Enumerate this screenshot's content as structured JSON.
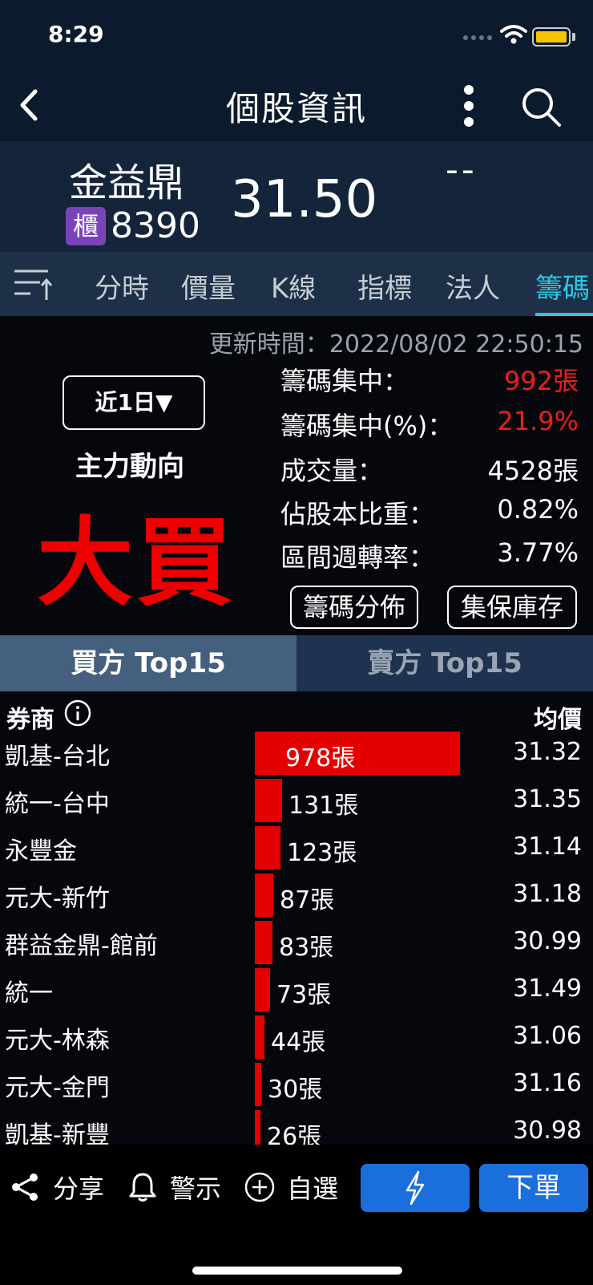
{
  "status": {
    "time": "8:29"
  },
  "nav": {
    "title": "個股資訊"
  },
  "stock": {
    "name": "金益鼎",
    "market_badge": "櫃",
    "code": "8390",
    "price": "31.50",
    "change": "--"
  },
  "tabs": [
    {
      "label": "分時",
      "active": false
    },
    {
      "label": "價量",
      "active": false
    },
    {
      "label": "K線",
      "active": false
    },
    {
      "label": "指標",
      "active": false
    },
    {
      "label": "法人",
      "active": false
    },
    {
      "label": "籌碼",
      "active": true
    }
  ],
  "info": {
    "update_time": "更新時間：2022/08/02 22:50:15",
    "period_button": "近1日▼",
    "main_force_label": "主力動向",
    "main_force_value": "大買",
    "stats": [
      {
        "label": "籌碼集中：",
        "value": "992張",
        "highlight": true
      },
      {
        "label": "籌碼集中(%)：",
        "value": "21.9%",
        "highlight": true
      },
      {
        "label": "成交量：",
        "value": "4528張",
        "highlight": false
      },
      {
        "label": "佔股本比重：",
        "value": "0.82%",
        "highlight": false
      },
      {
        "label": "區間週轉率：",
        "value": "3.77%",
        "highlight": false
      }
    ],
    "distribution_button": "籌碼分佈",
    "depository_button": "集保庫存"
  },
  "buy_sell_tabs": {
    "buy": "買方 Top15",
    "sell": "賣方 Top15"
  },
  "table": {
    "header_broker": "券商",
    "header_avg": "均價",
    "rows": [
      {
        "name": "凱基-台北",
        "qty": 978,
        "qty_label": "978張",
        "avg": "31.32"
      },
      {
        "name": "統一-台中",
        "qty": 131,
        "qty_label": "131張",
        "avg": "31.35"
      },
      {
        "name": "永豐金",
        "qty": 123,
        "qty_label": "123張",
        "avg": "31.14"
      },
      {
        "name": "元大-新竹",
        "qty": 87,
        "qty_label": "87張",
        "avg": "31.18"
      },
      {
        "name": "群益金鼎-館前",
        "qty": 83,
        "qty_label": "83張",
        "avg": "30.99"
      },
      {
        "name": "統一",
        "qty": 73,
        "qty_label": "73張",
        "avg": "31.49"
      },
      {
        "name": "元大-林森",
        "qty": 44,
        "qty_label": "44張",
        "avg": "31.06"
      },
      {
        "name": "元大-金門",
        "qty": 30,
        "qty_label": "30張",
        "avg": "31.16"
      },
      {
        "name": "凱基-新豐",
        "qty": 26,
        "qty_label": "26張",
        "avg": "30.98"
      }
    ]
  },
  "bottom": {
    "share": "分享",
    "alert": "警示",
    "watchlist": "自選",
    "order": "下單"
  },
  "colors": {
    "accent": "#2dc8e6",
    "buy_red": "#e40000",
    "button_blue": "#1b6fdc",
    "badge_purple": "#7a44b8"
  }
}
